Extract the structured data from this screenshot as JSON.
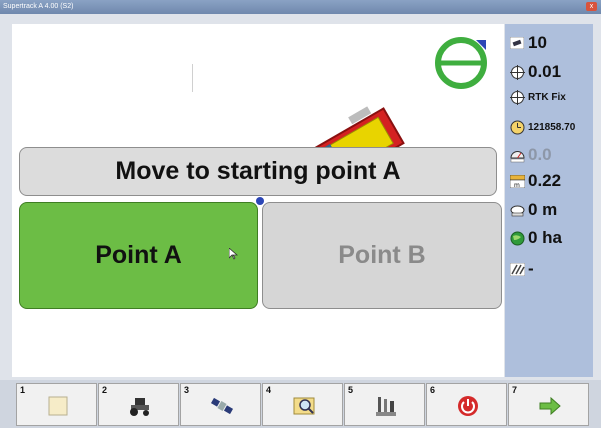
{
  "window": {
    "title": "Supertrack A 4.00 (S2)",
    "close_glyph": "x"
  },
  "main": {
    "banner": "Move to starting point A",
    "point_a_label": "Point A",
    "point_b_label": "Point B"
  },
  "status": {
    "satellites": "10",
    "precision": "0.01",
    "fix_type": "RTK Fix",
    "time": "121858.70",
    "speed": "0.0",
    "offset": "0.22",
    "distance": "0 m",
    "area": "0 ha",
    "implement": "-"
  },
  "toolbar": {
    "buttons": [
      {
        "num": "1",
        "icon": "blank-page-icon"
      },
      {
        "num": "2",
        "icon": "tractor-icon"
      },
      {
        "num": "3",
        "icon": "satellite-icon"
      },
      {
        "num": "4",
        "icon": "field-search-icon"
      },
      {
        "num": "5",
        "icon": "tools-icon"
      },
      {
        "num": "6",
        "icon": "power-icon"
      },
      {
        "num": "7",
        "icon": "next-arrow-icon"
      }
    ]
  },
  "colors": {
    "point_a": "#6cbd45",
    "status_panel": "#aebfdc",
    "compass": "#3fae3f",
    "tractor_body": "#e8d400",
    "tractor_frame": "#d02020"
  }
}
